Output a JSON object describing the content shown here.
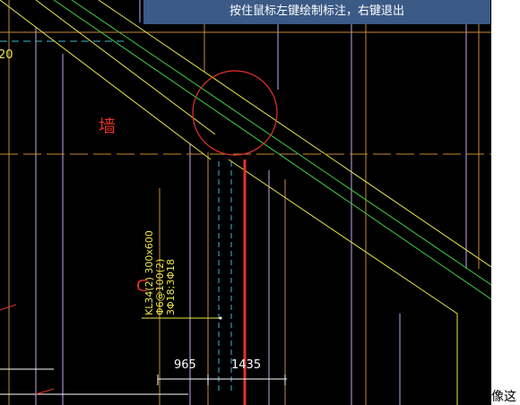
{
  "tooltip": {
    "text": "按住鼠标左键绘制标注，右键退出"
  },
  "canvas": {
    "wall_label": "墙",
    "left_edge_label": "20",
    "beam_annotation": [
      "KL34(2) 300x600",
      "Φ6@100(2)",
      "3Φ18;3Φ18"
    ],
    "dimensions": [
      "965",
      "1435"
    ],
    "cursor_glyph": "ᑕ"
  },
  "outside_text": "像这",
  "colors": {
    "background": "#000000",
    "line_yellow": "#e9e64a",
    "line_green": "#3fd13f",
    "line_orange": "#c98a2f",
    "line_purple": "#c7a3f4",
    "accent_red": "#e5322a",
    "tooltip_bg": "#3b5a86"
  }
}
